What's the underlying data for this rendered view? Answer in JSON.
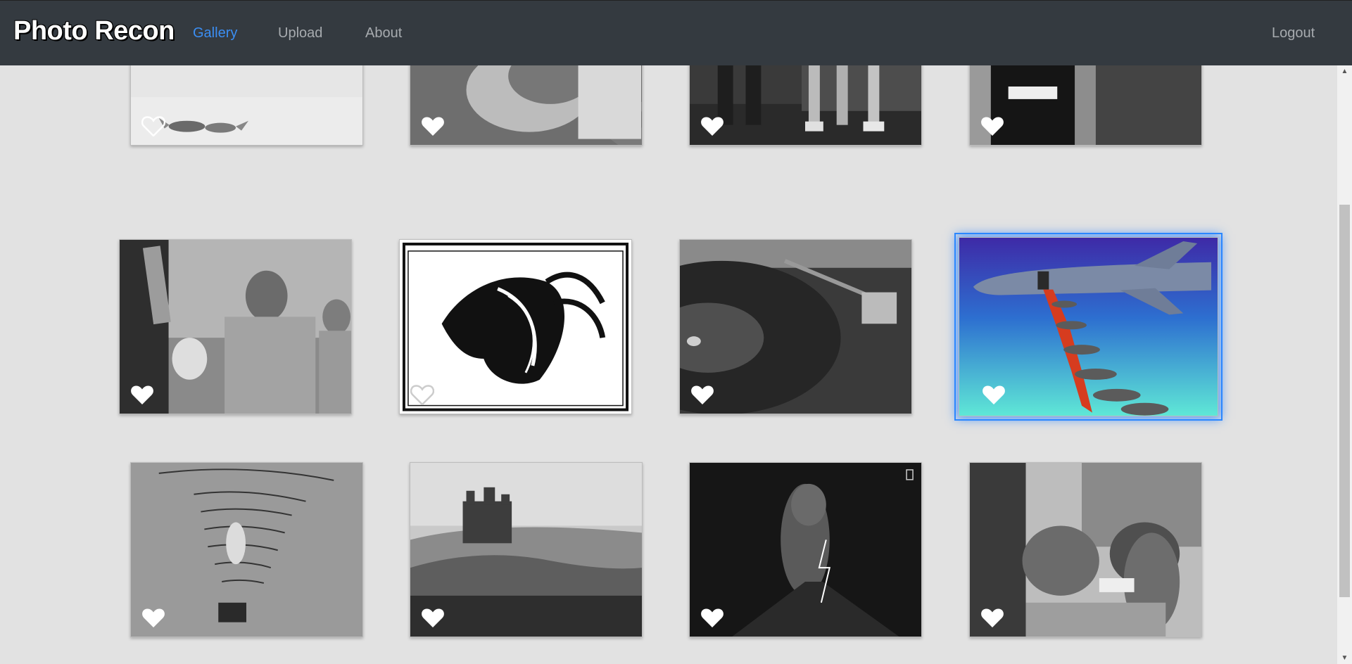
{
  "nav": {
    "brand": "Photo Recon",
    "links": [
      {
        "label": "Gallery",
        "active": true
      },
      {
        "label": "Upload",
        "active": false
      },
      {
        "label": "About",
        "active": false
      }
    ],
    "logout_label": "Logout"
  },
  "colors": {
    "navbar_bg": "#343a40",
    "page_bg": "#e2e2e2",
    "active_link": "#3b8ef3",
    "inactive_link": "#a7abaf",
    "selected_glow": "#2b87ff"
  },
  "gallery": {
    "items": [
      {
        "subject": "two foxes running on snow",
        "liked": false
      },
      {
        "subject": "tattooed leg on wooden floor",
        "liked": true
      },
      {
        "subject": "tattooed legs in sneakers",
        "liked": true
      },
      {
        "subject": "bearded man in tank top",
        "liked": true
      },
      {
        "subject": "shirtless man with sunglasses at party",
        "liked": true
      },
      {
        "subject": "ink drawing of ornate horse head",
        "liked": false
      },
      {
        "subject": "record player turntable",
        "liked": true
      },
      {
        "subject": "airplane dropping bombs on red carpet",
        "liked": true,
        "selected": true
      },
      {
        "subject": "man climbing on painted wall lines",
        "liked": true
      },
      {
        "subject": "castle on hill over landscape",
        "liked": true
      },
      {
        "subject": "volcano eruption with lightning",
        "liked": true
      },
      {
        "subject": "boy with tiger",
        "liked": true
      }
    ]
  },
  "icons": {
    "like": "heart-icon",
    "scroll_up": "scroll-up-arrow-icon",
    "scroll_down": "scroll-down-arrow-icon"
  }
}
